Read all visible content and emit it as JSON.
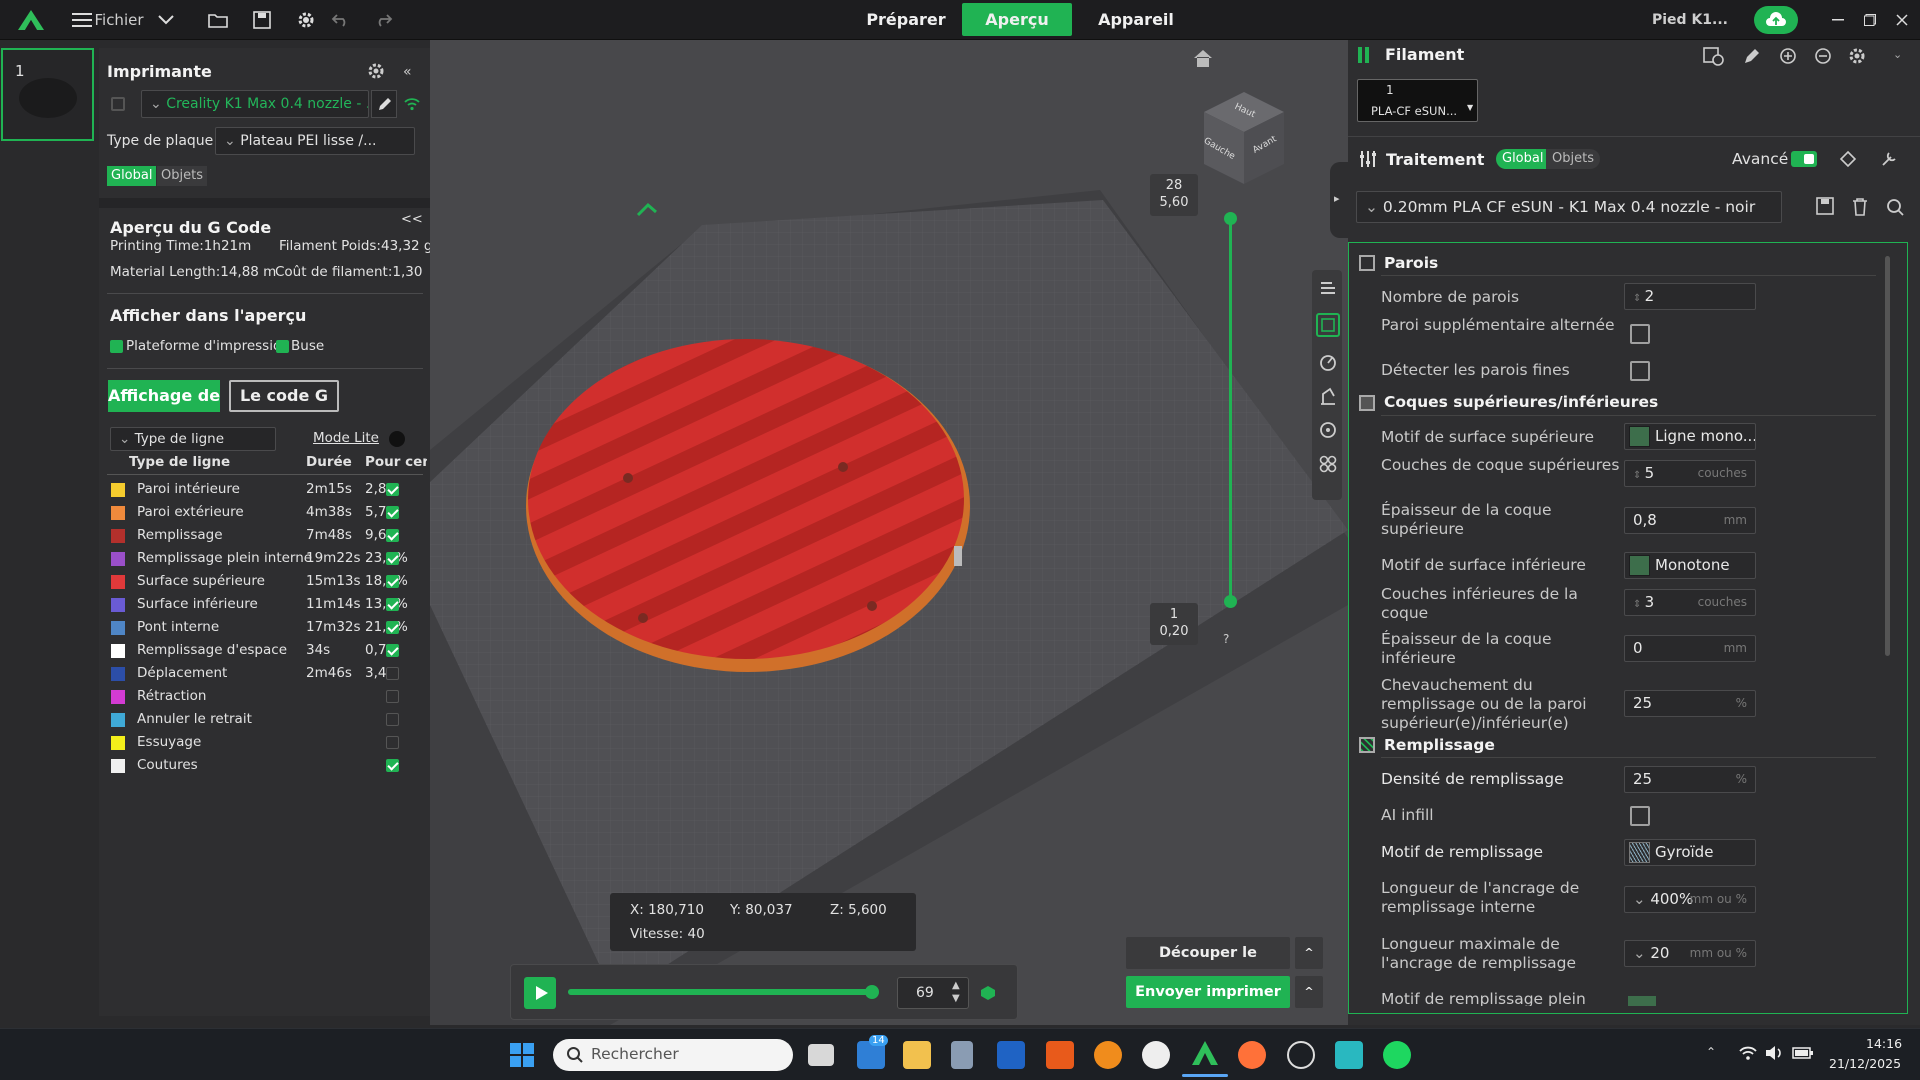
{
  "topbar": {
    "file_label": "Fichier",
    "modes": [
      "Préparer",
      "Aperçu",
      "Appareil"
    ],
    "active_mode": "Aperçu",
    "device_label": "Pied K1..."
  },
  "plate": {
    "number": "1"
  },
  "printer": {
    "title": "Imprimante",
    "preset": "Creality K1 Max 0.4 nozzle - ...",
    "plate_type_label": "Type de plaque",
    "plate_type_value": "Plateau PEI lisse /...",
    "toggle_global": "Global",
    "toggle_objects": "Objets"
  },
  "gcode_preview": {
    "title": "Aperçu du G Code",
    "collapse": "<<",
    "printing_time": "Printing Time:1h21m",
    "filament_weight": "Filament Poids:43,32 g",
    "material_length": "Material Length:14,88 m",
    "filament_cost": "Coût de filament:1,30"
  },
  "show_in_preview": {
    "title": "Afficher dans l'aperçu",
    "opt_platform": "Plateforme d'impression",
    "opt_nozzle": "Buse"
  },
  "preview_tabs": {
    "display": "Affichage des",
    "gcode": "Le code G"
  },
  "line_type": {
    "select_label": "Type de ligne",
    "mode_lite": "Mode Lite",
    "col_type": "Type de ligne",
    "col_duration": "Durée",
    "col_percent": "Pour cen",
    "rows": [
      {
        "name": "Paroi intérieure",
        "duration": "2m15s",
        "percent": "2,8%",
        "color": "#f5cc2e",
        "checked": true
      },
      {
        "name": "Paroi extérieure",
        "duration": "4m38s",
        "percent": "5,7%",
        "color": "#f08a3c",
        "checked": true
      },
      {
        "name": "Remplissage",
        "duration": "7m48s",
        "percent": "9,6%",
        "color": "#b3302c",
        "checked": true
      },
      {
        "name": "Remplissage plein interne",
        "duration": "19m22s",
        "percent": "23,8%",
        "color": "#9a4fc9",
        "checked": true
      },
      {
        "name": "Surface supérieure",
        "duration": "15m13s",
        "percent": "18,7%",
        "color": "#e0393a",
        "checked": true
      },
      {
        "name": "Surface inférieure",
        "duration": "11m14s",
        "percent": "13,8%",
        "color": "#6a5bd4",
        "checked": true
      },
      {
        "name": "Pont interne",
        "duration": "17m32s",
        "percent": "21,5%",
        "color": "#4f86c6",
        "checked": true
      },
      {
        "name": "Remplissage d'espace",
        "duration": "34s",
        "percent": "0,7%",
        "color": "#ffffff",
        "checked": true
      },
      {
        "name": "Déplacement",
        "duration": "2m46s",
        "percent": "3,4%",
        "color": "#2c4ea8",
        "checked": false
      },
      {
        "name": "Rétraction",
        "duration": "",
        "percent": "",
        "color": "#d33bd3",
        "checked": false
      },
      {
        "name": "Annuler le retrait",
        "duration": "",
        "percent": "",
        "color": "#3fa9d6",
        "checked": false
      },
      {
        "name": "Essuyage",
        "duration": "",
        "percent": "",
        "color": "#f4ef1b",
        "checked": false
      },
      {
        "name": "Coutures",
        "duration": "",
        "percent": "",
        "color": "#f0f0f0",
        "checked": true
      }
    ]
  },
  "viewport": {
    "cube_top": "Haut",
    "cube_left": "Gauche",
    "cube_front": "Avant",
    "layer_top_num": "28",
    "layer_top_height": "5,60",
    "layer_bottom_num": "1",
    "layer_bottom_height": "0,20",
    "help": "?",
    "coord_x": "X: 180,710",
    "coord_y": "Y: 80,037",
    "coord_z": "Z: 5,600",
    "speed": "Vitesse: 40",
    "progress_value": "69",
    "progress_fraction": 0.98,
    "btn_slice": "Découper le plateau",
    "btn_send": "Envoyer imprimer"
  },
  "filament": {
    "title": "Filament",
    "slot_number": "1",
    "slot_name": "PLA-CF eSUN..."
  },
  "process": {
    "title": "Traitement",
    "toggle_global": "Global",
    "toggle_objects": "Objets",
    "advanced": "Avancé",
    "preset": "0.20mm PLA CF eSUN - K1 Max 0.4 nozzle - noir"
  },
  "settings": {
    "walls": {
      "title": "Parois",
      "wall_count_label": "Nombre de parois",
      "wall_count": "2",
      "alt_wall_label": "Paroi supplémentaire alternée",
      "thin_walls_label": "Détecter les parois fines"
    },
    "shells": {
      "title": "Coques supérieures/inférieures",
      "top_pattern_label": "Motif de surface supérieure",
      "top_pattern": "Ligne mono...",
      "top_layers_label": "Couches de coque supérieures",
      "top_layers": "5",
      "top_layers_unit": "couches",
      "top_thick_label": "Épaisseur de la coque supérieure",
      "top_thick": "0,8",
      "mm": "mm",
      "bottom_pattern_label": "Motif de surface inférieure",
      "bottom_pattern": "Monotone",
      "bottom_layers_label": "Couches inférieures de la coque",
      "bottom_layers": "3",
      "bottom_layers_unit": "couches",
      "bottom_thick_label": "Épaisseur de la coque inférieure",
      "bottom_thick": "0",
      "overlap_label": "Chevauchement du remplissage ou de la paroi supérieur(e)/inférieur(e)",
      "overlap": "25",
      "percent": "%"
    },
    "infill": {
      "title": "Remplissage",
      "density_label": "Densité de remplissage",
      "density": "25",
      "ai_label": "AI infill",
      "pattern_label": "Motif de remplissage",
      "pattern": "Gyroïde",
      "anchor_label": "Longueur de l'ancrage de remplissage interne",
      "anchor": "400%",
      "anchor_unit": "mm ou %",
      "anchor_max_label": "Longueur maximale de l'ancrage de remplissage",
      "anchor_max": "20",
      "anchor_max_unit": "mm ou %",
      "solid_pattern_label": "Motif de remplissage plein"
    }
  },
  "taskbar": {
    "search": "Rechercher",
    "badge": "14",
    "time": "14:16",
    "date": "21/12/2025"
  }
}
